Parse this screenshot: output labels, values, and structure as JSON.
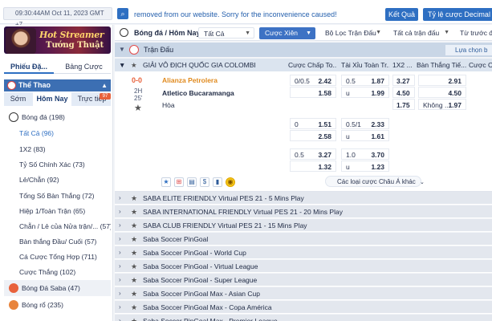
{
  "topbar": {
    "time": "09:30:44AM Oct 11, 2023 GMT +7",
    "marquee": "removed from our website. Sorry for the inconvenience caused!",
    "result_button": "Kết Quả",
    "odds_type": "Tỷ lệ cược Decimal"
  },
  "sidebar": {
    "banner_line1": "Hot Streamer",
    "banner_line2": "Tướng Thuật",
    "tabs": [
      "Phiếu Đặ...",
      "Bảng Cược"
    ],
    "sports_header": "Thể Thao",
    "time_tabs": [
      "Sớm",
      "Hôm Nay",
      "Trực tiếp"
    ],
    "live_count": "97",
    "football": "Bóng đá (198)",
    "sub_items": [
      "Tất Cả (96)",
      "1X2 (83)",
      "Tỷ Số Chính Xác (73)",
      "Lẻ/Chẵn (92)",
      "Tổng Số Bàn Thắng (72)",
      "Hiệp 1/Toàn Trận (65)",
      "Chẵn / Lẻ của Nửa trận/... (57)",
      "Bàn thắng Đầu/ Cuối (57)",
      "Cá Cược Tổng Hợp (711)",
      "Cược Thắng (102)"
    ],
    "saba": "Bóng Đá Saba (47)",
    "basketball": "Bóng rổ (235)"
  },
  "main": {
    "title": "Bóng đá / Hôm Nay",
    "filter_all": "Tất Cả",
    "combo_button": "Cược Xiên",
    "filter_match": "Bộ Lọc Trận Đấu",
    "filter_league": "Tất cả trận đấu",
    "filter_prev": "Từ trước đế",
    "section_title": "Trận Đấu",
    "section_right": "Lựa chọn b",
    "league": {
      "name": "GIẢI VÔ ĐỊCH QUỐC GIA COLOMBIA",
      "columns": [
        "Cược Chấp To...",
        "Tài Xỉu Toàn Tr...",
        "1X2 ...",
        "Bàn Thắng Tiế...",
        "Cược Ch"
      ]
    },
    "match": {
      "score": "0-0",
      "period": "2H",
      "minute": "25'",
      "home": "Alianza Petrolera",
      "away": "Atletico Bucaramanga",
      "draw": "Hòa",
      "rows": [
        {
          "hcp_line": "0/0.5",
          "hcp_home": "2.42",
          "hcp_away": "1.58",
          "ou_line": "0.5",
          "ou_over": "1.87",
          "ou_under_label": "u",
          "ou_under": "1.99",
          "x12": [
            "3.27",
            "4.50",
            "1.75"
          ],
          "ng_1": "2.91",
          "ng_2": "4.50",
          "ng_3_label": "Không ...",
          "ng_3": "1.97"
        },
        {
          "hcp_line": "0",
          "hcp_home": "1.51",
          "hcp_away": "2.58",
          "ou_line": "0.5/1",
          "ou_over": "2.33",
          "ou_under_label": "u",
          "ou_under": "1.61"
        },
        {
          "hcp_line": "0.5",
          "hcp_home": "3.27",
          "hcp_away": "1.32",
          "ou_line": "1.0",
          "ou_over": "3.70",
          "ou_under_label": "u",
          "ou_under": "1.23"
        }
      ]
    },
    "more_bets": "Các loại cược Châu Á khác",
    "leagues": [
      "SABA ELITE FRIENDLY Virtual PES 21 - 5 Mins Play",
      "SABA INTERNATIONAL FRIENDLY Virtual PES 21 - 20 Mins Play",
      "SABA CLUB FRIENDLY Virtual PES 21 - 15 Mins Play",
      "Saba Soccer PinGoal",
      "Saba Soccer PinGoal - World Cup",
      "Saba Soccer PinGoal - Virtual League",
      "Saba Soccer PinGoal - Super League",
      "Saba Soccer PinGoal Max - Asian Cup",
      "Saba Soccer PinGoal Max - Copa América",
      "Saba Soccer PinGoal Max - Premier League"
    ]
  }
}
